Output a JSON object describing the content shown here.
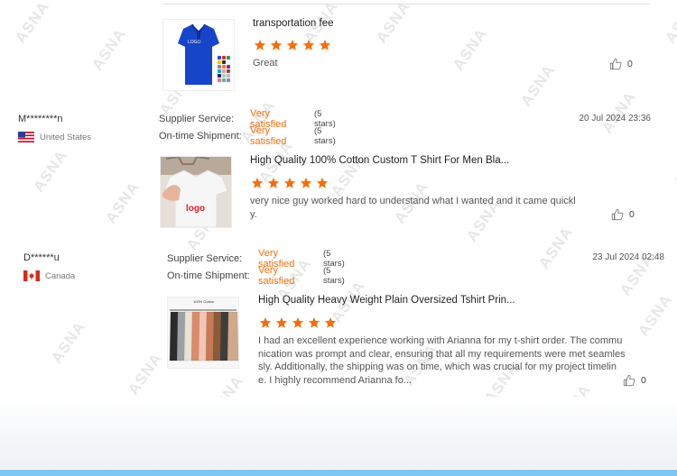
{
  "watermark": "ASNA",
  "accent_color": "#f46e0d",
  "reviews": [
    {
      "product_title": "transportation fee",
      "rating": 5,
      "comment": "Great",
      "likes": "0"
    },
    {
      "reviewer": "M********n",
      "country": "United States",
      "date": "20 Jul 2024 23:36",
      "supplier_service_label": "Supplier Service:",
      "supplier_service_value": "Very satisfied",
      "supplier_service_stars": "(5 stars)",
      "shipment_label": "On-time Shipment:",
      "shipment_value": "Very satisfied",
      "shipment_stars": "(5 stars)",
      "product_title": "High Quality 100% Cotton Custom T Shirt For Men Bla...",
      "rating": 5,
      "comment_lines": [
        "very nice guy worked hard to understand what I wanted and it came quickl",
        "y."
      ],
      "likes": "0"
    },
    {
      "reviewer": "D******u",
      "country": "Canada",
      "date": "23 Jul 2024 02:48",
      "supplier_service_label": "Supplier Service:",
      "supplier_service_value": "Very satisfied",
      "supplier_service_stars": "(5 stars)",
      "shipment_label": "On-time Shipment:",
      "shipment_value": "Very satisfied",
      "shipment_stars": "(5 stars)",
      "product_title": "High Quality Heavy Weight Plain Oversized Tshirt Prin...",
      "rating": 5,
      "comment_lines": [
        "I had an excellent experience working with Arianna for my t-shirt order. The commu",
        "nication was prompt and clear, ensuring that all my requirements were met seamles",
        "sly. Additionally, the shipping was on time, which was crucial for my project timelin",
        "e. I highly recommend Arianna fo..."
      ],
      "likes": "0"
    }
  ],
  "thumb_text": {
    "polo_logo": "LOGO",
    "tee_logo": "logo",
    "oversized_label": "100% Cotton"
  }
}
